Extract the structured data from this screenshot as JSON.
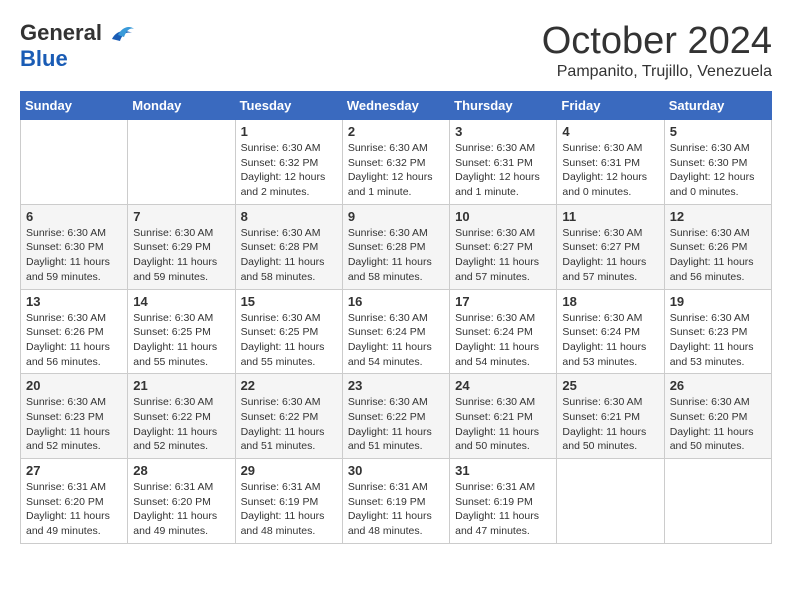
{
  "logo": {
    "general": "General",
    "blue": "Blue"
  },
  "title": "October 2024",
  "subtitle": "Pampanito, Trujillo, Venezuela",
  "days_header": [
    "Sunday",
    "Monday",
    "Tuesday",
    "Wednesday",
    "Thursday",
    "Friday",
    "Saturday"
  ],
  "weeks": [
    [
      {
        "day": "",
        "info": ""
      },
      {
        "day": "",
        "info": ""
      },
      {
        "day": "1",
        "info": "Sunrise: 6:30 AM\nSunset: 6:32 PM\nDaylight: 12 hours\nand 2 minutes."
      },
      {
        "day": "2",
        "info": "Sunrise: 6:30 AM\nSunset: 6:32 PM\nDaylight: 12 hours\nand 1 minute."
      },
      {
        "day": "3",
        "info": "Sunrise: 6:30 AM\nSunset: 6:31 PM\nDaylight: 12 hours\nand 1 minute."
      },
      {
        "day": "4",
        "info": "Sunrise: 6:30 AM\nSunset: 6:31 PM\nDaylight: 12 hours\nand 0 minutes."
      },
      {
        "day": "5",
        "info": "Sunrise: 6:30 AM\nSunset: 6:30 PM\nDaylight: 12 hours\nand 0 minutes."
      }
    ],
    [
      {
        "day": "6",
        "info": "Sunrise: 6:30 AM\nSunset: 6:30 PM\nDaylight: 11 hours\nand 59 minutes."
      },
      {
        "day": "7",
        "info": "Sunrise: 6:30 AM\nSunset: 6:29 PM\nDaylight: 11 hours\nand 59 minutes."
      },
      {
        "day": "8",
        "info": "Sunrise: 6:30 AM\nSunset: 6:28 PM\nDaylight: 11 hours\nand 58 minutes."
      },
      {
        "day": "9",
        "info": "Sunrise: 6:30 AM\nSunset: 6:28 PM\nDaylight: 11 hours\nand 58 minutes."
      },
      {
        "day": "10",
        "info": "Sunrise: 6:30 AM\nSunset: 6:27 PM\nDaylight: 11 hours\nand 57 minutes."
      },
      {
        "day": "11",
        "info": "Sunrise: 6:30 AM\nSunset: 6:27 PM\nDaylight: 11 hours\nand 57 minutes."
      },
      {
        "day": "12",
        "info": "Sunrise: 6:30 AM\nSunset: 6:26 PM\nDaylight: 11 hours\nand 56 minutes."
      }
    ],
    [
      {
        "day": "13",
        "info": "Sunrise: 6:30 AM\nSunset: 6:26 PM\nDaylight: 11 hours\nand 56 minutes."
      },
      {
        "day": "14",
        "info": "Sunrise: 6:30 AM\nSunset: 6:25 PM\nDaylight: 11 hours\nand 55 minutes."
      },
      {
        "day": "15",
        "info": "Sunrise: 6:30 AM\nSunset: 6:25 PM\nDaylight: 11 hours\nand 55 minutes."
      },
      {
        "day": "16",
        "info": "Sunrise: 6:30 AM\nSunset: 6:24 PM\nDaylight: 11 hours\nand 54 minutes."
      },
      {
        "day": "17",
        "info": "Sunrise: 6:30 AM\nSunset: 6:24 PM\nDaylight: 11 hours\nand 54 minutes."
      },
      {
        "day": "18",
        "info": "Sunrise: 6:30 AM\nSunset: 6:24 PM\nDaylight: 11 hours\nand 53 minutes."
      },
      {
        "day": "19",
        "info": "Sunrise: 6:30 AM\nSunset: 6:23 PM\nDaylight: 11 hours\nand 53 minutes."
      }
    ],
    [
      {
        "day": "20",
        "info": "Sunrise: 6:30 AM\nSunset: 6:23 PM\nDaylight: 11 hours\nand 52 minutes."
      },
      {
        "day": "21",
        "info": "Sunrise: 6:30 AM\nSunset: 6:22 PM\nDaylight: 11 hours\nand 52 minutes."
      },
      {
        "day": "22",
        "info": "Sunrise: 6:30 AM\nSunset: 6:22 PM\nDaylight: 11 hours\nand 51 minutes."
      },
      {
        "day": "23",
        "info": "Sunrise: 6:30 AM\nSunset: 6:22 PM\nDaylight: 11 hours\nand 51 minutes."
      },
      {
        "day": "24",
        "info": "Sunrise: 6:30 AM\nSunset: 6:21 PM\nDaylight: 11 hours\nand 50 minutes."
      },
      {
        "day": "25",
        "info": "Sunrise: 6:30 AM\nSunset: 6:21 PM\nDaylight: 11 hours\nand 50 minutes."
      },
      {
        "day": "26",
        "info": "Sunrise: 6:30 AM\nSunset: 6:20 PM\nDaylight: 11 hours\nand 50 minutes."
      }
    ],
    [
      {
        "day": "27",
        "info": "Sunrise: 6:31 AM\nSunset: 6:20 PM\nDaylight: 11 hours\nand 49 minutes."
      },
      {
        "day": "28",
        "info": "Sunrise: 6:31 AM\nSunset: 6:20 PM\nDaylight: 11 hours\nand 49 minutes."
      },
      {
        "day": "29",
        "info": "Sunrise: 6:31 AM\nSunset: 6:19 PM\nDaylight: 11 hours\nand 48 minutes."
      },
      {
        "day": "30",
        "info": "Sunrise: 6:31 AM\nSunset: 6:19 PM\nDaylight: 11 hours\nand 48 minutes."
      },
      {
        "day": "31",
        "info": "Sunrise: 6:31 AM\nSunset: 6:19 PM\nDaylight: 11 hours\nand 47 minutes."
      },
      {
        "day": "",
        "info": ""
      },
      {
        "day": "",
        "info": ""
      }
    ]
  ]
}
